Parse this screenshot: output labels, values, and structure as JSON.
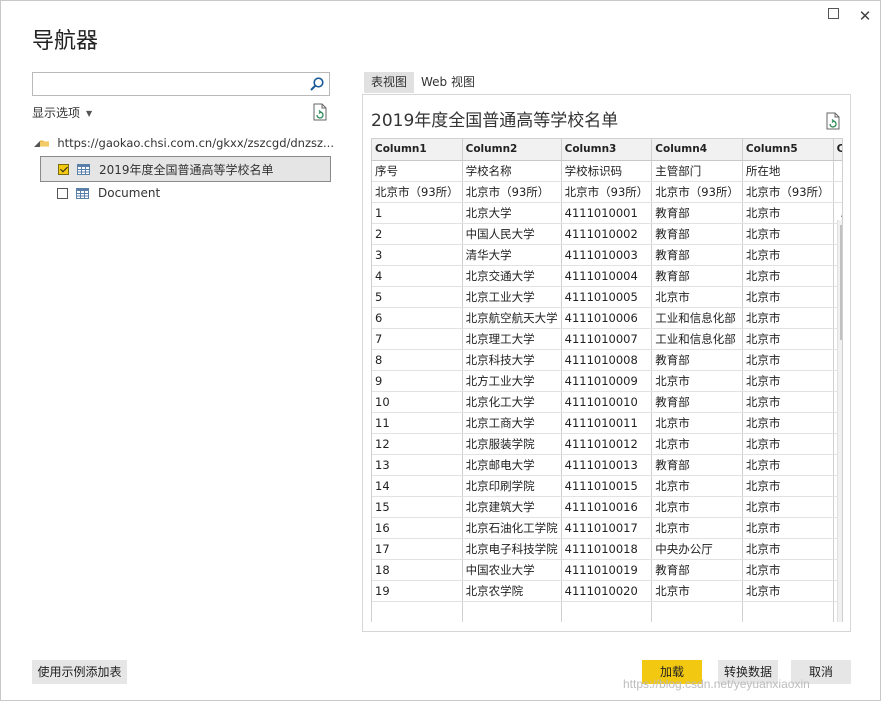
{
  "window": {
    "title": "导航器",
    "close_glyph": "✕"
  },
  "left": {
    "search": {
      "value": "",
      "placeholder": ""
    },
    "display_options": "显示选项",
    "tree": {
      "root_label": "https://gaokao.chsi.com.cn/gkxx/zszcgd/dnzsz...",
      "items": [
        {
          "label": "2019年度全国普通高等学校名单",
          "checked": true
        },
        {
          "label": "Document",
          "checked": false
        }
      ]
    },
    "add_table_button": "使用示例添加表"
  },
  "tabs": [
    {
      "label": "表视图"
    },
    {
      "label": "Web 视图"
    }
  ],
  "preview": {
    "title": "2019年度全国普通高等学校名单",
    "columns": [
      "Column1",
      "Column2",
      "Column3",
      "Column4",
      "Column5",
      "Co"
    ],
    "rows": [
      [
        "序号",
        "学校名称",
        "学校标识码",
        "主管部门",
        "所在地",
        ""
      ],
      [
        "北京市（93所）",
        "北京市（93所）",
        "北京市（93所）",
        "北京市（93所）",
        "北京市（93所）",
        ""
      ],
      [
        "1",
        "北京大学",
        "4111010001",
        "教育部",
        "北京市",
        ""
      ],
      [
        "2",
        "中国人民大学",
        "4111010002",
        "教育部",
        "北京市",
        ""
      ],
      [
        "3",
        "清华大学",
        "4111010003",
        "教育部",
        "北京市",
        ""
      ],
      [
        "4",
        "北京交通大学",
        "4111010004",
        "教育部",
        "北京市",
        ""
      ],
      [
        "5",
        "北京工业大学",
        "4111010005",
        "北京市",
        "北京市",
        ""
      ],
      [
        "6",
        "北京航空航天大学",
        "4111010006",
        "工业和信息化部",
        "北京市",
        ""
      ],
      [
        "7",
        "北京理工大学",
        "4111010007",
        "工业和信息化部",
        "北京市",
        ""
      ],
      [
        "8",
        "北京科技大学",
        "4111010008",
        "教育部",
        "北京市",
        ""
      ],
      [
        "9",
        "北方工业大学",
        "4111010009",
        "北京市",
        "北京市",
        ""
      ],
      [
        "10",
        "北京化工大学",
        "4111010010",
        "教育部",
        "北京市",
        ""
      ],
      [
        "11",
        "北京工商大学",
        "4111010011",
        "北京市",
        "北京市",
        ""
      ],
      [
        "12",
        "北京服装学院",
        "4111010012",
        "北京市",
        "北京市",
        ""
      ],
      [
        "13",
        "北京邮电大学",
        "4111010013",
        "教育部",
        "北京市",
        ""
      ],
      [
        "14",
        "北京印刷学院",
        "4111010015",
        "北京市",
        "北京市",
        ""
      ],
      [
        "15",
        "北京建筑大学",
        "4111010016",
        "北京市",
        "北京市",
        ""
      ],
      [
        "16",
        "北京石油化工学院",
        "4111010017",
        "北京市",
        "北京市",
        ""
      ],
      [
        "17",
        "北京电子科技学院",
        "4111010018",
        "中央办公厅",
        "北京市",
        ""
      ],
      [
        "18",
        "中国农业大学",
        "4111010019",
        "教育部",
        "北京市",
        ""
      ],
      [
        "19",
        "北京农学院",
        "4111010020",
        "北京市",
        "北京市",
        ""
      ],
      [
        "",
        "",
        "",
        "",
        "",
        ""
      ]
    ]
  },
  "buttons": {
    "load": "加载",
    "transform": "转换数据",
    "cancel": "取消"
  },
  "watermark": "https://blog.csdn.net/yeyuanxiaoxin",
  "colors": {
    "accent": "#f2c811"
  }
}
